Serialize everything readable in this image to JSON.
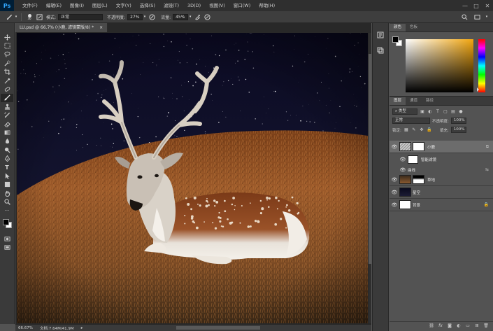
{
  "app": {
    "logo": "Ps"
  },
  "menu": [
    "文件(F)",
    "编辑(E)",
    "图像(I)",
    "图层(L)",
    "文字(Y)",
    "选择(S)",
    "滤镜(T)",
    "3D(D)",
    "视图(V)",
    "窗口(W)",
    "帮助(H)"
  ],
  "window_controls": {
    "minimize": "—",
    "maximize": "□",
    "close": "✕"
  },
  "options": {
    "brush_size": "30",
    "mode_label": "模式:",
    "mode_value": "正常",
    "opacity_label": "不透明度:",
    "opacity_value": "27%",
    "flow_label": "流量:",
    "flow_value": "45%"
  },
  "document": {
    "tab_title": "LU.psd @ 66.7% (小鹿, 滤镜蒙版/8) *",
    "tab_close": "×",
    "zoom": "66.67%",
    "doc_info": "文档:7.64M/41.9M"
  },
  "color_panel": {
    "tabs": [
      "颜色",
      "色板"
    ]
  },
  "layers_panel": {
    "tabs": [
      "图层",
      "通道",
      "路径"
    ],
    "filter_label": "类型",
    "blend_mode": "正常",
    "opacity_label": "不透明度:",
    "opacity_value": "100%",
    "lock_label": "锁定:",
    "fill_label": "填充:",
    "fill_value": "100%",
    "layers": [
      {
        "name": "小鹿",
        "selected": true
      },
      {
        "name": "智能滤镜",
        "sub": true
      },
      {
        "name": "曲线",
        "sub": true
      },
      {
        "name": "草地"
      },
      {
        "name": "星空"
      },
      {
        "name": "背景"
      }
    ]
  },
  "colors": {
    "accent": "#31a8ff",
    "panel": "#535353",
    "dark": "#2f2f2f"
  }
}
